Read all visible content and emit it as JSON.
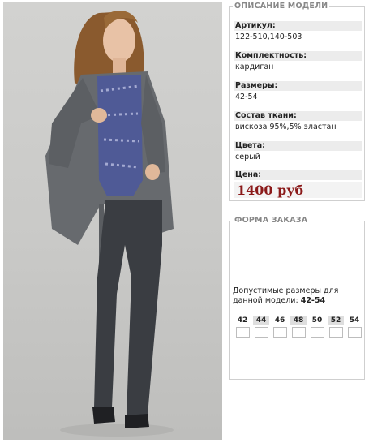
{
  "photo": {
    "alt_subject": "model"
  },
  "description": {
    "legend": "ОПИСАНИЕ МОДЕЛИ",
    "article_label": "Артикул:",
    "article_value": "122-510,140-503",
    "set_label": "Комплектность:",
    "set_value": "кардиган",
    "sizes_label": "Размеры:",
    "sizes_value": "42-54",
    "fabric_label": "Состав ткани:",
    "fabric_value": "вискоза 95%,5% эластан",
    "color_label": "Цвета:",
    "color_value": "серый",
    "price_label": "Цена:",
    "price_value": "1400 руб"
  },
  "order": {
    "legend": "ФОРМА ЗАКАЗА",
    "allowed_text": "Допустимые размеры для данной модели:",
    "allowed_range": "42-54",
    "sizes": [
      {
        "label": "42",
        "checked": false
      },
      {
        "label": "44",
        "checked": false
      },
      {
        "label": "46",
        "checked": false
      },
      {
        "label": "48",
        "checked": false
      },
      {
        "label": "50",
        "checked": false
      },
      {
        "label": "52",
        "checked": false
      },
      {
        "label": "54",
        "checked": false
      }
    ]
  },
  "colors": {
    "price": "#8b1a1a",
    "label_bg": "#ececec",
    "border": "#cfcfcf",
    "legend": "#888888"
  }
}
